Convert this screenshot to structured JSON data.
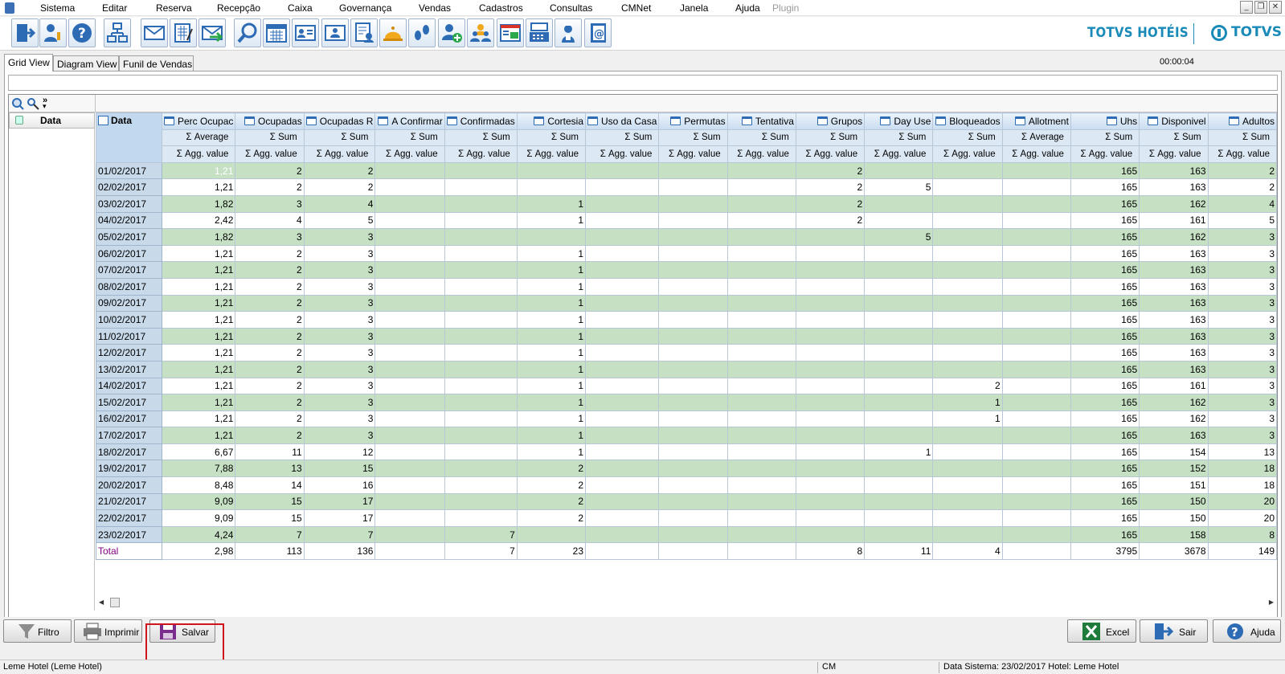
{
  "menu": {
    "items": [
      "Sistema",
      "Editar",
      "Reserva",
      "Recepção",
      "Caixa",
      "Governança",
      "Vendas",
      "Cadastros",
      "Consultas",
      "CMNet",
      "Janela",
      "Ajuda"
    ],
    "plugin": "Plugin",
    "window_buttons": [
      "_",
      "❐",
      "✕"
    ]
  },
  "logo": {
    "hoteis": "TOTVS HOTÉIS",
    "totvs": "TOTVS"
  },
  "toolbar_icons": [
    "exit-icon",
    "user-key-icon",
    "help-icon",
    "network-icon",
    "mail-icon",
    "form-icon",
    "send-mail-icon",
    "search-icon",
    "calendar-icon",
    "guest-card-icon",
    "reception-icon",
    "housekeeping-report-icon",
    "bell-icon",
    "footsteps-icon",
    "add-guest-icon",
    "group-icon",
    "cashier-icon",
    "register-icon",
    "maid-icon",
    "email-book-icon"
  ],
  "tabs": [
    "Grid View",
    "Diagram View",
    "Funil de Vendas"
  ],
  "timer": "00:00:04",
  "pivot": {
    "row_field": "Data",
    "corner_label": "Data",
    "columns": [
      {
        "name": "Perc Ocupac",
        "agg": "Average",
        "sub": "Agg. value"
      },
      {
        "name": "Ocupadas",
        "agg": "Sum",
        "sub": "Agg. value"
      },
      {
        "name": "Ocupadas R",
        "agg": "Sum",
        "sub": "Agg. value"
      },
      {
        "name": "A Confirmar",
        "agg": "Sum",
        "sub": "Agg. value"
      },
      {
        "name": "Confirmadas",
        "agg": "Sum",
        "sub": "Agg. value"
      },
      {
        "name": "Cortesia",
        "agg": "Sum",
        "sub": "Agg. value"
      },
      {
        "name": "Uso da Casa",
        "agg": "Sum",
        "sub": "Agg. value"
      },
      {
        "name": "Permutas",
        "agg": "Sum",
        "sub": "Agg. value"
      },
      {
        "name": "Tentativa",
        "agg": "Sum",
        "sub": "Agg. value"
      },
      {
        "name": "Grupos",
        "agg": "Sum",
        "sub": "Agg. value"
      },
      {
        "name": "Day Use",
        "agg": "Sum",
        "sub": "Agg. value"
      },
      {
        "name": "Bloqueados",
        "agg": "Sum",
        "sub": "Agg. value"
      },
      {
        "name": "Allotment",
        "agg": "Average",
        "sub": "Agg. value"
      },
      {
        "name": "Uhs",
        "agg": "Sum",
        "sub": "Agg. value"
      },
      {
        "name": "Disponivel",
        "agg": "Sum",
        "sub": "Agg. value"
      },
      {
        "name": "Adultos",
        "agg": "Sum",
        "sub": "Agg. value"
      }
    ],
    "rows": [
      {
        "label": "01/02/2017",
        "values": [
          "1,21",
          "2",
          "2",
          "",
          "",
          "",
          "",
          "",
          "",
          "2",
          "",
          "",
          "",
          "165",
          "163",
          "2"
        ]
      },
      {
        "label": "02/02/2017",
        "values": [
          "1,21",
          "2",
          "2",
          "",
          "",
          "",
          "",
          "",
          "",
          "2",
          "5",
          "",
          "",
          "165",
          "163",
          "2"
        ]
      },
      {
        "label": "03/02/2017",
        "values": [
          "1,82",
          "3",
          "4",
          "",
          "",
          "1",
          "",
          "",
          "",
          "2",
          "",
          "",
          "",
          "165",
          "162",
          "4"
        ]
      },
      {
        "label": "04/02/2017",
        "values": [
          "2,42",
          "4",
          "5",
          "",
          "",
          "1",
          "",
          "",
          "",
          "2",
          "",
          "",
          "",
          "165",
          "161",
          "5"
        ]
      },
      {
        "label": "05/02/2017",
        "values": [
          "1,82",
          "3",
          "3",
          "",
          "",
          "",
          "",
          "",
          "",
          "",
          "5",
          "",
          "",
          "165",
          "162",
          "3"
        ]
      },
      {
        "label": "06/02/2017",
        "values": [
          "1,21",
          "2",
          "3",
          "",
          "",
          "1",
          "",
          "",
          "",
          "",
          "",
          "",
          "",
          "165",
          "163",
          "3"
        ]
      },
      {
        "label": "07/02/2017",
        "values": [
          "1,21",
          "2",
          "3",
          "",
          "",
          "1",
          "",
          "",
          "",
          "",
          "",
          "",
          "",
          "165",
          "163",
          "3"
        ]
      },
      {
        "label": "08/02/2017",
        "values": [
          "1,21",
          "2",
          "3",
          "",
          "",
          "1",
          "",
          "",
          "",
          "",
          "",
          "",
          "",
          "165",
          "163",
          "3"
        ]
      },
      {
        "label": "09/02/2017",
        "values": [
          "1,21",
          "2",
          "3",
          "",
          "",
          "1",
          "",
          "",
          "",
          "",
          "",
          "",
          "",
          "165",
          "163",
          "3"
        ]
      },
      {
        "label": "10/02/2017",
        "values": [
          "1,21",
          "2",
          "3",
          "",
          "",
          "1",
          "",
          "",
          "",
          "",
          "",
          "",
          "",
          "165",
          "163",
          "3"
        ]
      },
      {
        "label": "11/02/2017",
        "values": [
          "1,21",
          "2",
          "3",
          "",
          "",
          "1",
          "",
          "",
          "",
          "",
          "",
          "",
          "",
          "165",
          "163",
          "3"
        ]
      },
      {
        "label": "12/02/2017",
        "values": [
          "1,21",
          "2",
          "3",
          "",
          "",
          "1",
          "",
          "",
          "",
          "",
          "",
          "",
          "",
          "165",
          "163",
          "3"
        ]
      },
      {
        "label": "13/02/2017",
        "values": [
          "1,21",
          "2",
          "3",
          "",
          "",
          "1",
          "",
          "",
          "",
          "",
          "",
          "",
          "",
          "165",
          "163",
          "3"
        ]
      },
      {
        "label": "14/02/2017",
        "values": [
          "1,21",
          "2",
          "3",
          "",
          "",
          "1",
          "",
          "",
          "",
          "",
          "",
          "2",
          "",
          "165",
          "161",
          "3"
        ]
      },
      {
        "label": "15/02/2017",
        "values": [
          "1,21",
          "2",
          "3",
          "",
          "",
          "1",
          "",
          "",
          "",
          "",
          "",
          "1",
          "",
          "165",
          "162",
          "3"
        ]
      },
      {
        "label": "16/02/2017",
        "values": [
          "1,21",
          "2",
          "3",
          "",
          "",
          "1",
          "",
          "",
          "",
          "",
          "",
          "1",
          "",
          "165",
          "162",
          "3"
        ]
      },
      {
        "label": "17/02/2017",
        "values": [
          "1,21",
          "2",
          "3",
          "",
          "",
          "1",
          "",
          "",
          "",
          "",
          "",
          "",
          "",
          "165",
          "163",
          "3"
        ]
      },
      {
        "label": "18/02/2017",
        "values": [
          "6,67",
          "11",
          "12",
          "",
          "",
          "1",
          "",
          "",
          "",
          "",
          "1",
          "",
          "",
          "165",
          "154",
          "13"
        ]
      },
      {
        "label": "19/02/2017",
        "values": [
          "7,88",
          "13",
          "15",
          "",
          "",
          "2",
          "",
          "",
          "",
          "",
          "",
          "",
          "",
          "165",
          "152",
          "18"
        ]
      },
      {
        "label": "20/02/2017",
        "values": [
          "8,48",
          "14",
          "16",
          "",
          "",
          "2",
          "",
          "",
          "",
          "",
          "",
          "",
          "",
          "165",
          "151",
          "18"
        ]
      },
      {
        "label": "21/02/2017",
        "values": [
          "9,09",
          "15",
          "17",
          "",
          "",
          "2",
          "",
          "",
          "",
          "",
          "",
          "",
          "",
          "165",
          "150",
          "20"
        ]
      },
      {
        "label": "22/02/2017",
        "values": [
          "9,09",
          "15",
          "17",
          "",
          "",
          "2",
          "",
          "",
          "",
          "",
          "",
          "",
          "",
          "165",
          "150",
          "20"
        ]
      },
      {
        "label": "23/02/2017",
        "values": [
          "4,24",
          "7",
          "7",
          "",
          "7",
          "",
          "",
          "",
          "",
          "",
          "",
          "",
          "",
          "165",
          "158",
          "8"
        ]
      }
    ],
    "total": {
      "label": "Total",
      "values": [
        "2,98",
        "113",
        "136",
        "",
        "7",
        "23",
        "",
        "",
        "",
        "8",
        "11",
        "4",
        "",
        "3795",
        "3678",
        "149"
      ]
    }
  },
  "buttons": {
    "filtro": "Filtro",
    "imprimir": "Imprimir",
    "salvar": "Salvar",
    "excel": "Excel",
    "sair": "Sair",
    "ajuda": "Ajuda"
  },
  "status": {
    "hotel": "Leme Hotel (Leme Hotel)",
    "user": "CM",
    "data_sistema": "Data Sistema: 23/02/2017  Hotel: Leme Hotel"
  }
}
